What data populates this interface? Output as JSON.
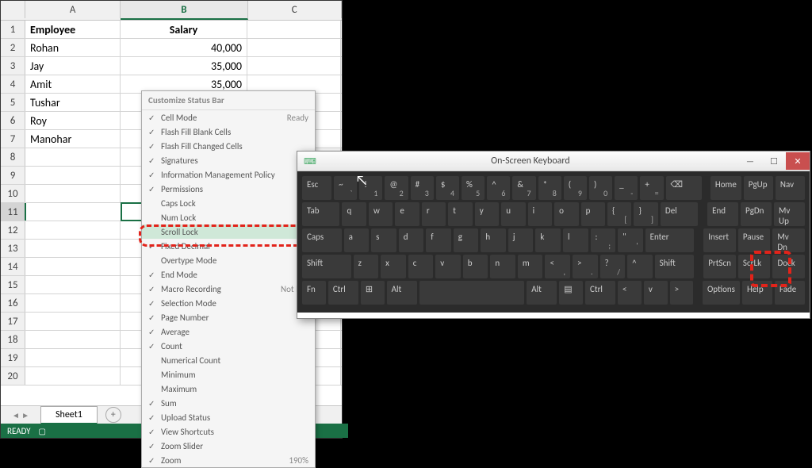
{
  "columns": {
    "A": "A",
    "B": "B",
    "C": "C"
  },
  "headers": {
    "employee": "Employee",
    "salary": "Salary"
  },
  "rows": [
    {
      "n": "1",
      "a": "Employee",
      "b": "Salary"
    },
    {
      "n": "2",
      "a": "Rohan",
      "b": "40,000"
    },
    {
      "n": "3",
      "a": "Jay",
      "b": "35,000"
    },
    {
      "n": "4",
      "a": "Amit",
      "b": "35,000"
    },
    {
      "n": "5",
      "a": "Tushar",
      "b": ""
    },
    {
      "n": "6",
      "a": "Roy",
      "b": ""
    },
    {
      "n": "7",
      "a": "Manohar",
      "b": ""
    },
    {
      "n": "8",
      "a": "",
      "b": ""
    },
    {
      "n": "9",
      "a": "",
      "b": ""
    },
    {
      "n": "10",
      "a": "",
      "b": ""
    },
    {
      "n": "11",
      "a": "",
      "b": ""
    },
    {
      "n": "12",
      "a": "",
      "b": ""
    },
    {
      "n": "13",
      "a": "",
      "b": ""
    },
    {
      "n": "14",
      "a": "",
      "b": ""
    },
    {
      "n": "15",
      "a": "",
      "b": ""
    },
    {
      "n": "16",
      "a": "",
      "b": ""
    },
    {
      "n": "17",
      "a": "",
      "b": ""
    },
    {
      "n": "18",
      "a": "",
      "b": ""
    },
    {
      "n": "19",
      "a": "",
      "b": ""
    },
    {
      "n": "20",
      "a": "",
      "b": ""
    }
  ],
  "tab": {
    "name": "Sheet1",
    "plus": "+"
  },
  "status": {
    "text": "READY"
  },
  "ctxmenu": {
    "title": "Customize Status Bar",
    "items": [
      {
        "c": "✓",
        "l": "Cell Mode",
        "v": "Ready"
      },
      {
        "c": "✓",
        "l": "Flash Fill Blank Cells",
        "v": ""
      },
      {
        "c": "✓",
        "l": "Flash Fill Changed Cells",
        "v": ""
      },
      {
        "c": "✓",
        "l": "Signatures",
        "v": ""
      },
      {
        "c": "✓",
        "l": "Information Management Policy",
        "v": ""
      },
      {
        "c": "✓",
        "l": "Permissions",
        "v": ""
      },
      {
        "c": "",
        "l": "Caps Lock",
        "v": ""
      },
      {
        "c": "",
        "l": "Num Lock",
        "v": ""
      },
      {
        "c": "",
        "l": "Scroll Lock",
        "v": "",
        "hl": true
      },
      {
        "c": "✓",
        "l": "Fixed Decimal",
        "v": ""
      },
      {
        "c": "",
        "l": "Overtype Mode",
        "v": ""
      },
      {
        "c": "✓",
        "l": "End Mode",
        "v": ""
      },
      {
        "c": "✓",
        "l": "Macro Recording",
        "v": "Not Rec"
      },
      {
        "c": "✓",
        "l": "Selection Mode",
        "v": ""
      },
      {
        "c": "✓",
        "l": "Page Number",
        "v": ""
      },
      {
        "c": "✓",
        "l": "Average",
        "v": ""
      },
      {
        "c": "✓",
        "l": "Count",
        "v": ""
      },
      {
        "c": "",
        "l": "Numerical Count",
        "v": ""
      },
      {
        "c": "",
        "l": "Minimum",
        "v": ""
      },
      {
        "c": "",
        "l": "Maximum",
        "v": ""
      },
      {
        "c": "✓",
        "l": "Sum",
        "v": ""
      },
      {
        "c": "✓",
        "l": "Upload Status",
        "v": ""
      },
      {
        "c": "✓",
        "l": "View Shortcuts",
        "v": ""
      },
      {
        "c": "✓",
        "l": "Zoom Slider",
        "v": ""
      },
      {
        "c": "✓",
        "l": "Zoom",
        "v": "190%"
      }
    ]
  },
  "osk": {
    "title": "On-Screen Keyboard",
    "row1": [
      "Esc",
      "~\n`",
      "!\n1",
      "@\n2",
      "#\n3",
      "$\n4",
      "%\n5",
      "^\n6",
      "&\n7",
      "*\n8",
      "(\n9",
      ")\n0",
      "_\n-",
      "+\n=",
      "⌫",
      "Home",
      "PgUp",
      "Nav"
    ],
    "row2": [
      "Tab",
      "q",
      "w",
      "e",
      "r",
      "t",
      "y",
      "u",
      "i",
      "o",
      "p",
      "{\n[",
      "}\n]",
      "Del",
      "End",
      "PgDn",
      "Mv Up"
    ],
    "row3": [
      "Caps",
      "a",
      "s",
      "d",
      "f",
      "g",
      "h",
      "j",
      "k",
      "l",
      ":\n;",
      "\"\n'",
      "Enter",
      "Insert",
      "Pause",
      "Mv Dn"
    ],
    "row4": [
      "Shift",
      "z",
      "x",
      "c",
      "v",
      "b",
      "n",
      "m",
      "<\n,",
      ">\n.",
      "?\n/",
      "^",
      "Shift",
      "PrtScn",
      "ScrLk",
      "Dock"
    ],
    "row5": [
      "Fn",
      "Ctrl",
      "⊞",
      "Alt",
      " ",
      "Alt",
      "▤",
      "Ctrl",
      "<",
      "v",
      ">",
      "Options",
      "Help",
      "Fade"
    ]
  }
}
